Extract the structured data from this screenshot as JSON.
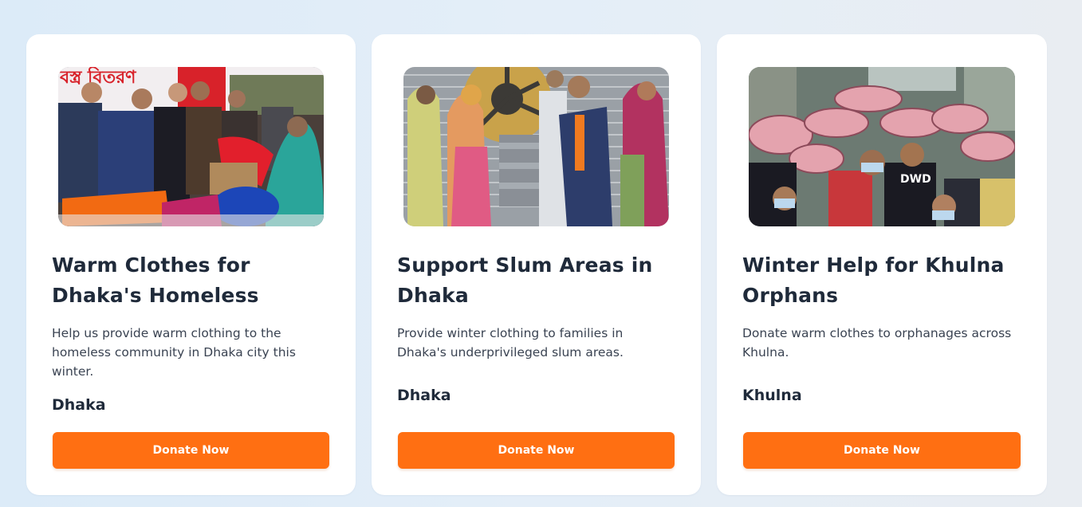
{
  "campaigns": [
    {
      "title": "Warm Clothes for Dhaka's Homeless",
      "description": "Help us provide warm clothing to the homeless community in Dhaka city this winter.",
      "location": "Dhaka",
      "button_label": "Donate Now",
      "image_alt": "Volunteers handing out blankets to people in Dhaka",
      "banner_text": "বস্ত্র বিতরণ"
    },
    {
      "title": "Support Slum Areas in Dhaka",
      "description": "Provide winter clothing to families in Dhaka's underprivileged slum areas.",
      "location": "Dhaka",
      "button_label": "Donate Now",
      "image_alt": "Volunteers giving folded blankets to women in a slum"
    },
    {
      "title": "Winter Help for Khulna Orphans",
      "description": "Donate warm clothes to orphanages across Khulna.",
      "location": "Khulna",
      "button_label": "Donate Now",
      "image_alt": "Children carrying rolled blankets above their heads"
    }
  ],
  "colors": {
    "accent": "#ff6f12",
    "heading": "#1f2a3a",
    "body_text": "#3a4352",
    "card_bg": "#ffffff"
  }
}
